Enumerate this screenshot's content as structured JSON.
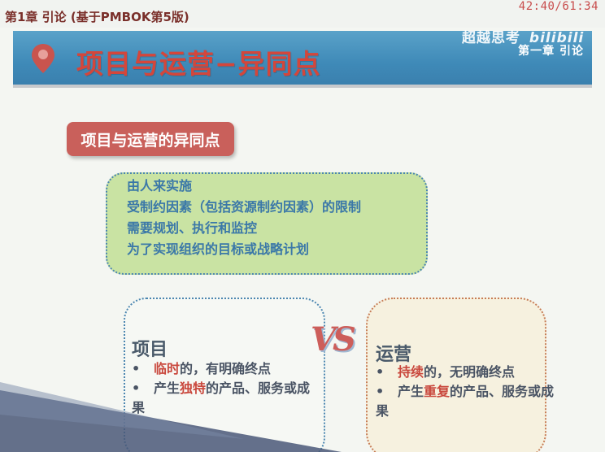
{
  "header": {
    "chapter_label": "第1章 引论 (基于PMBOK第5版)",
    "timer": "42:40/61:34"
  },
  "banner": {
    "title": "项目与运营−异同点",
    "watermark_text": "超越思考",
    "watermark_logo": "bilibili",
    "chapter": "第一章  引论",
    "color": "#4a91bf"
  },
  "section_button": {
    "label": "项目与运营的异同点",
    "color": "#c9605b"
  },
  "common": {
    "lines": [
      "由人来实施",
      "受制约因素（包括资源制约因素）的限制",
      "需要规划、执行和监控",
      "为了实现组织的目标或战略计划"
    ]
  },
  "vs_label": "VS",
  "project": {
    "heading": "项目",
    "bullet_char": "•",
    "bullet1_highlight": "临时",
    "bullet1_rest": "的，有明确终点",
    "bullet2_prefix": "产生",
    "bullet2_highlight": "独特",
    "bullet2_rest": "的产品、服务或成",
    "bullet2_wrap": "果"
  },
  "operations": {
    "heading": "运营",
    "bullet_char": "•",
    "bullet1_highlight": "持续",
    "bullet1_rest": "的，无明确终点",
    "bullet2_prefix": "产生",
    "bullet2_highlight": "重复",
    "bullet2_rest": "的产品、服务或成",
    "bullet2_wrap": "果"
  }
}
